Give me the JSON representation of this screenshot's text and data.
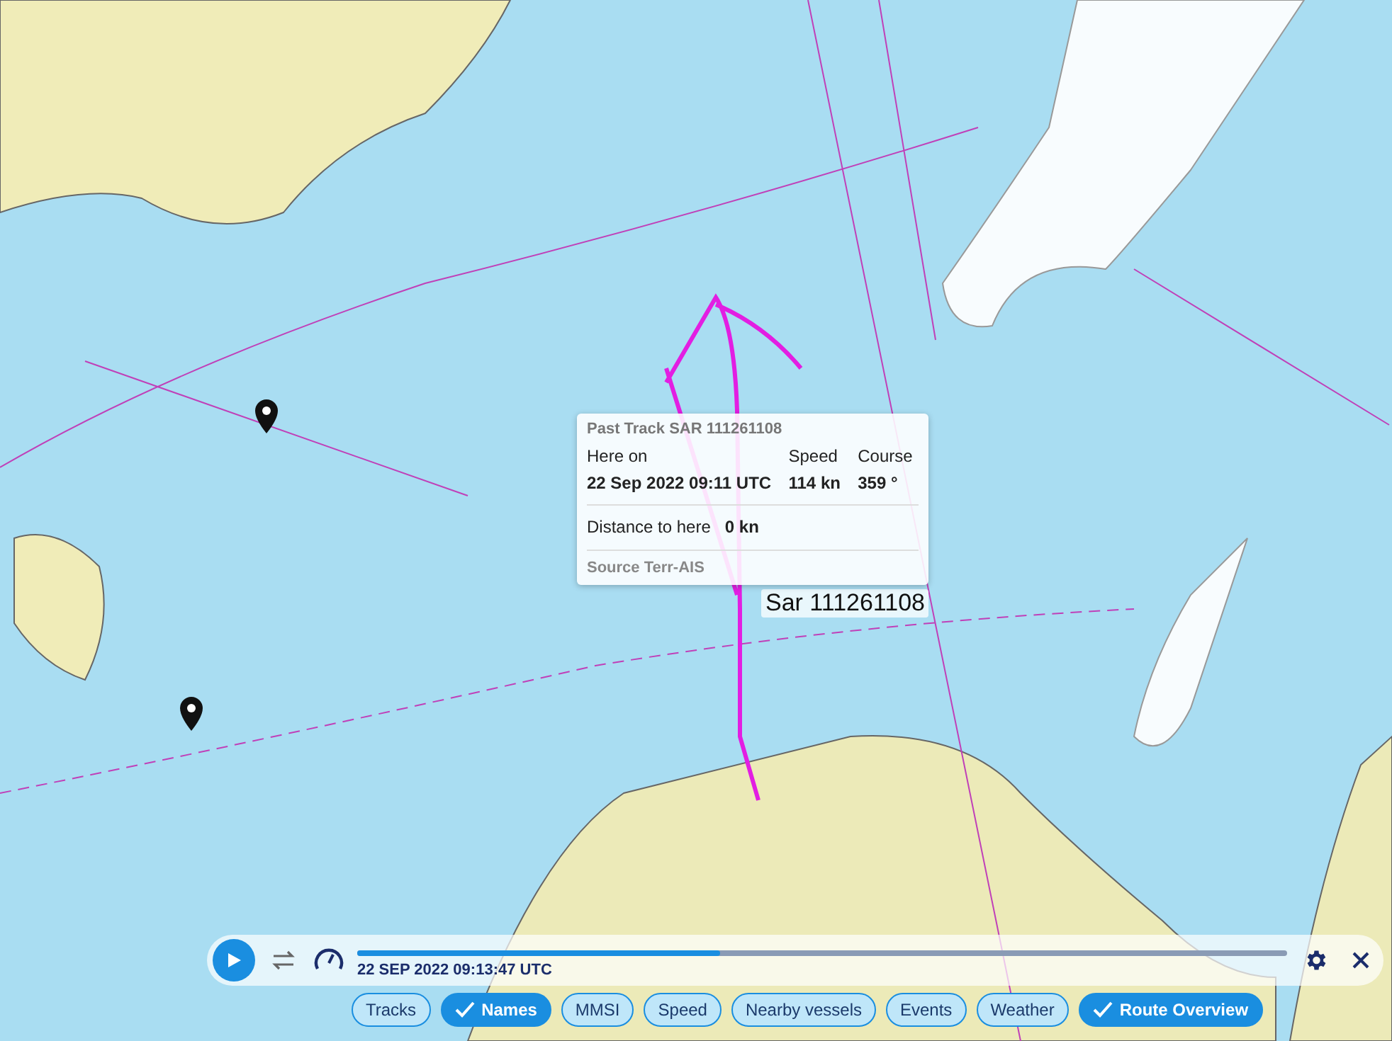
{
  "map": {
    "vessel_label": "Sar 111261108"
  },
  "tooltip": {
    "title": "Past Track SAR 111261108",
    "here_on_label": "Here on",
    "here_on_value": "22 Sep 2022 09:11 UTC",
    "speed_label": "Speed",
    "speed_value": "114 kn",
    "course_label": "Course",
    "course_value": "359 °",
    "distance_label": "Distance to here",
    "distance_value": "0 kn",
    "source": "Source Terr-AIS"
  },
  "playback": {
    "playing": false,
    "level": 0.39,
    "timestamp": "22 SEP 2022 09:13:47 UTC"
  },
  "filters": [
    {
      "label": "Tracks",
      "selected": false
    },
    {
      "label": "Names",
      "selected": true
    },
    {
      "label": "MMSI",
      "selected": false
    },
    {
      "label": "Speed",
      "selected": false
    },
    {
      "label": "Nearby vessels",
      "selected": false
    },
    {
      "label": "Events",
      "selected": false
    },
    {
      "label": "Weather",
      "selected": false
    },
    {
      "label": "Route Overview",
      "selected": true
    }
  ]
}
